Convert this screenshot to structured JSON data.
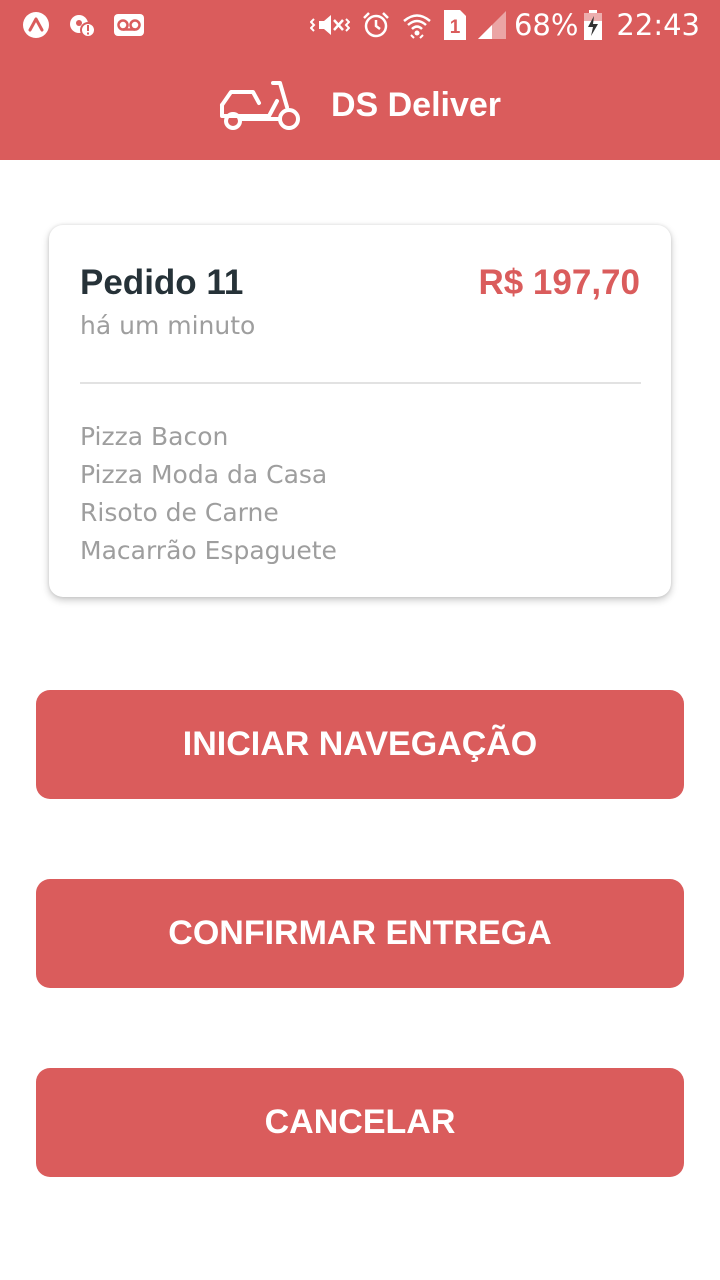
{
  "status_bar": {
    "icons_left": [
      "app-notification-icon",
      "location-alert-icon",
      "voicemail-icon"
    ],
    "icons_right": [
      "mute-vibrate-icon",
      "alarm-icon",
      "wifi-icon",
      "sim-1-icon",
      "signal-icon"
    ],
    "battery_percent": "68%",
    "time": "22:43"
  },
  "app_bar": {
    "logo_icon": "motorcycle-icon",
    "title": "DS Deliver"
  },
  "order": {
    "title": "Pedido 11",
    "price": "R$ 197,70",
    "time": "há um minuto",
    "products": [
      "Pizza Bacon",
      "Pizza Moda da Casa",
      "Risoto de Carne",
      "Macarrão Espaguete"
    ]
  },
  "actions": {
    "start_navigation": "INICIAR NAVEGAÇÃO",
    "confirm_delivery": "CONFIRMAR ENTREGA",
    "cancel": "CANCELAR"
  },
  "colors": {
    "primary": "#da5c5c",
    "title_text": "#263238",
    "secondary_text": "#9e9e9e",
    "background": "#ffffff"
  }
}
